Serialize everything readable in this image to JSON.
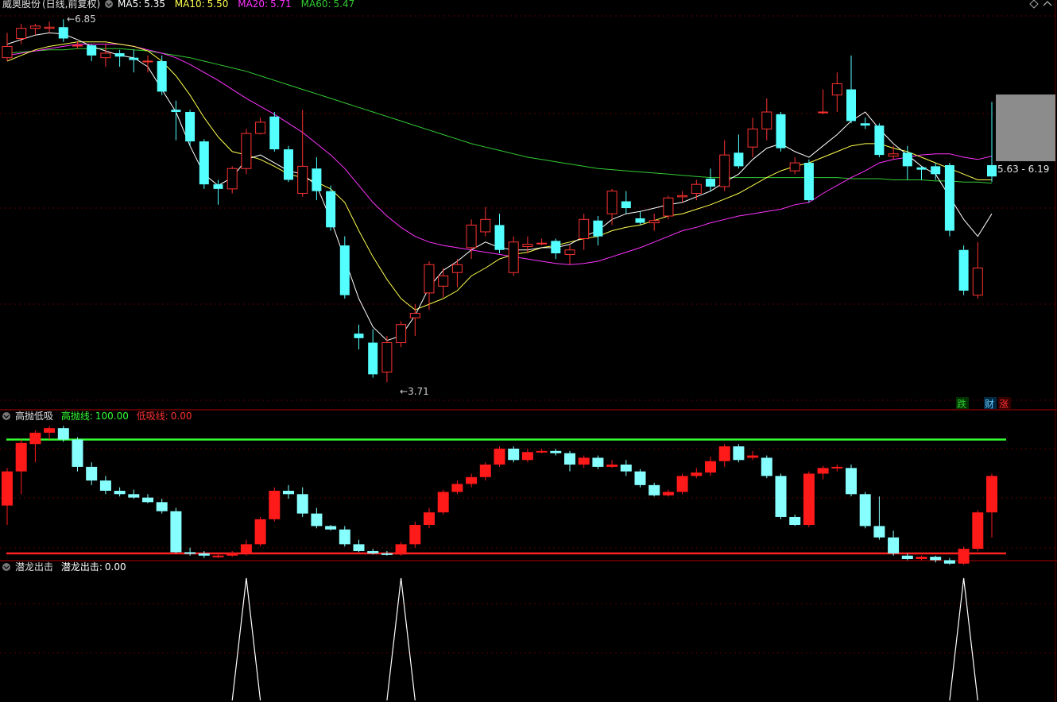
{
  "header": {
    "stock_name": "威奥股份",
    "mode": "(日线,前复权)",
    "ma": [
      {
        "label": "MA5:",
        "value": "5.35",
        "color": "#ffffff"
      },
      {
        "label": "MA10:",
        "value": "5.50",
        "color": "#ffff4d"
      },
      {
        "label": "MA20:",
        "value": "5.71",
        "color": "#ff33ff"
      },
      {
        "label": "MA60:",
        "value": "5.47",
        "color": "#33cc33"
      }
    ]
  },
  "annotations": {
    "high_label": "6.85",
    "low_label": "3.71",
    "range_label": "5.63 - 6.19",
    "badges": [
      {
        "text": "跌",
        "color": "#33cc33"
      },
      {
        "text": "财",
        "color": "#66ccff"
      },
      {
        "text": "涨",
        "color": "#ff3333"
      }
    ]
  },
  "panel2": {
    "title": "高抛低吸",
    "items": [
      {
        "label": "高抛线:",
        "value": "100.00",
        "color": "#33ff33"
      },
      {
        "label": "低吸线:",
        "value": "0.00",
        "color": "#ff3333"
      }
    ]
  },
  "panel3": {
    "title": "潜龙出击",
    "items": [
      {
        "label": "潜龙出击:",
        "value": "0.00",
        "color": "#ffffff"
      }
    ]
  },
  "colors": {
    "up": "#ff3333",
    "down": "#54ffff",
    "ma5": "#ffffff",
    "ma10": "#ffff4d",
    "ma20": "#ff33ff",
    "ma60": "#33cc33",
    "grid": "#5a0000",
    "border": "#b00000"
  },
  "chart_data": [
    {
      "type": "candlestick",
      "title": "威奥股份 (日线,前复权)",
      "price_range": [
        3.6,
        6.95
      ],
      "high": 6.85,
      "low": 3.71,
      "candles": [
        [
          6.58,
          6.68,
          6.8,
          6.55
        ],
        [
          6.75,
          6.84,
          6.88,
          6.7
        ],
        [
          6.84,
          6.86,
          6.88,
          6.78
        ],
        [
          6.84,
          6.85,
          6.9,
          6.8
        ],
        [
          6.85,
          6.75,
          6.92,
          6.72
        ],
        [
          6.69,
          6.69,
          6.72,
          6.66
        ],
        [
          6.69,
          6.6,
          6.7,
          6.55
        ],
        [
          6.58,
          6.62,
          6.7,
          6.5
        ],
        [
          6.62,
          6.59,
          6.65,
          6.5
        ],
        [
          6.58,
          6.56,
          6.65,
          6.45
        ],
        [
          6.55,
          6.55,
          6.6,
          6.45
        ],
        [
          6.55,
          6.28,
          6.6,
          6.25
        ],
        [
          6.12,
          6.1,
          6.2,
          5.85
        ],
        [
          6.1,
          5.84,
          6.12,
          5.8
        ],
        [
          5.84,
          5.46,
          5.86,
          5.42
        ],
        [
          5.46,
          5.42,
          5.5,
          5.28
        ],
        [
          5.42,
          5.6,
          5.62,
          5.38
        ],
        [
          5.6,
          5.91,
          5.95,
          5.55
        ],
        [
          5.91,
          6.01,
          6.05,
          5.9
        ],
        [
          6.06,
          5.77,
          6.1,
          5.75
        ],
        [
          5.77,
          5.5,
          5.8,
          5.48
        ],
        [
          5.38,
          5.62,
          6.12,
          5.35
        ],
        [
          5.6,
          5.4,
          5.7,
          5.32
        ],
        [
          5.4,
          5.08,
          5.45,
          5.05
        ],
        [
          4.92,
          4.48,
          5.0,
          4.45
        ],
        [
          4.14,
          4.1,
          4.22,
          4.0
        ],
        [
          4.06,
          3.78,
          4.18,
          3.75
        ],
        [
          3.8,
          4.06,
          4.12,
          3.71
        ],
        [
          4.06,
          4.22,
          4.25,
          4.02
        ],
        [
          4.28,
          4.32,
          4.4,
          4.12
        ],
        [
          4.5,
          4.75,
          4.78,
          4.35
        ],
        [
          4.56,
          4.65,
          4.72,
          4.46
        ],
        [
          4.68,
          4.75,
          4.8,
          4.55
        ],
        [
          4.9,
          5.1,
          5.15,
          4.8
        ],
        [
          5.04,
          5.15,
          5.26,
          5.0
        ],
        [
          5.1,
          4.88,
          5.2,
          4.85
        ],
        [
          4.68,
          4.95,
          5.0,
          4.65
        ],
        [
          4.91,
          4.93,
          5.0,
          4.85
        ],
        [
          4.94,
          4.94,
          4.98,
          4.92
        ],
        [
          4.96,
          4.85,
          4.98,
          4.8
        ],
        [
          4.84,
          4.88,
          4.92,
          4.75
        ],
        [
          4.98,
          5.15,
          5.2,
          4.88
        ],
        [
          5.14,
          5.0,
          5.18,
          4.92
        ],
        [
          5.2,
          5.4,
          5.42,
          5.1
        ],
        [
          5.31,
          5.25,
          5.4,
          5.2
        ],
        [
          5.16,
          5.12,
          5.22,
          5.1
        ],
        [
          5.12,
          5.14,
          5.2,
          5.05
        ],
        [
          5.18,
          5.34,
          5.36,
          5.15
        ],
        [
          5.35,
          5.36,
          5.4,
          5.3
        ],
        [
          5.38,
          5.46,
          5.5,
          5.32
        ],
        [
          5.51,
          5.44,
          5.6,
          5.4
        ],
        [
          5.44,
          5.72,
          5.85,
          5.4
        ],
        [
          5.74,
          5.62,
          5.9,
          5.6
        ],
        [
          5.79,
          5.95,
          6.05,
          5.7
        ],
        [
          5.95,
          6.1,
          6.22,
          5.85
        ],
        [
          6.08,
          5.78,
          6.1,
          5.75
        ],
        [
          5.58,
          5.65,
          5.7,
          5.55
        ],
        [
          5.65,
          5.32,
          5.68,
          5.3
        ],
        [
          6.1,
          6.1,
          6.3,
          6.08
        ],
        [
          6.25,
          6.35,
          6.45,
          6.1
        ],
        [
          6.3,
          6.02,
          6.6,
          6.0
        ],
        [
          6.0,
          5.98,
          6.05,
          5.95
        ],
        [
          5.98,
          5.72,
          6.0,
          5.7
        ],
        [
          5.71,
          5.73,
          5.8,
          5.68
        ],
        [
          5.74,
          5.62,
          5.8,
          5.5
        ],
        [
          5.61,
          5.59,
          5.62,
          5.5
        ],
        [
          5.62,
          5.55,
          5.65,
          5.5
        ],
        [
          5.63,
          5.05,
          5.65,
          5.0
        ],
        [
          4.88,
          4.52,
          4.92,
          4.48
        ],
        [
          4.48,
          4.72,
          4.95,
          4.45
        ],
        [
          5.63,
          5.53,
          6.19,
          5.48
        ]
      ],
      "ma5": [
        6.7,
        6.74,
        6.78,
        6.8,
        6.79,
        6.74,
        6.68,
        6.64,
        6.6,
        6.58,
        6.5,
        6.3,
        6.1,
        5.8,
        5.55,
        5.45,
        5.52,
        5.68,
        5.72,
        5.65,
        5.58,
        5.55,
        5.45,
        5.15,
        4.8,
        4.45,
        4.2,
        4.08,
        4.12,
        4.3,
        4.55,
        4.7,
        4.78,
        4.88,
        4.95,
        4.9,
        4.88,
        4.88,
        4.9,
        4.9,
        4.93,
        5.0,
        5.05,
        5.15,
        5.2,
        5.22,
        5.25,
        5.28,
        5.3,
        5.35,
        5.4,
        5.48,
        5.55,
        5.68,
        5.78,
        5.82,
        5.75,
        5.7,
        5.8,
        5.9,
        6.02,
        6.1,
        5.95,
        5.82,
        5.72,
        5.62,
        5.55,
        5.35,
        5.15,
        5.0,
        5.2
      ],
      "ma10": [
        6.55,
        6.6,
        6.65,
        6.68,
        6.7,
        6.72,
        6.72,
        6.72,
        6.7,
        6.68,
        6.64,
        6.55,
        6.42,
        6.25,
        6.05,
        5.88,
        5.75,
        5.72,
        5.68,
        5.62,
        5.55,
        5.52,
        5.48,
        5.42,
        5.3,
        5.05,
        4.82,
        4.62,
        4.45,
        4.35,
        4.4,
        4.45,
        4.52,
        4.65,
        4.72,
        4.8,
        4.84,
        4.86,
        4.9,
        4.92,
        4.95,
        4.98,
        5.0,
        5.05,
        5.08,
        5.1,
        5.14,
        5.18,
        5.2,
        5.24,
        5.28,
        5.33,
        5.38,
        5.45,
        5.52,
        5.58,
        5.62,
        5.65,
        5.7,
        5.75,
        5.8,
        5.82,
        5.82,
        5.78,
        5.75,
        5.7,
        5.65,
        5.6,
        5.55,
        5.5,
        5.5
      ],
      "ma20": [
        6.6,
        6.62,
        6.64,
        6.66,
        6.68,
        6.7,
        6.7,
        6.7,
        6.7,
        6.68,
        6.65,
        6.62,
        6.58,
        6.52,
        6.45,
        6.38,
        6.3,
        6.22,
        6.15,
        6.08,
        6.0,
        5.92,
        5.82,
        5.72,
        5.6,
        5.45,
        5.3,
        5.18,
        5.08,
        5.0,
        4.95,
        4.92,
        4.9,
        4.88,
        4.86,
        4.84,
        4.82,
        4.8,
        4.78,
        4.76,
        4.75,
        4.76,
        4.78,
        4.82,
        4.86,
        4.9,
        4.95,
        5.0,
        5.05,
        5.08,
        5.12,
        5.15,
        5.18,
        5.2,
        5.22,
        5.24,
        5.28,
        5.3,
        5.38,
        5.45,
        5.52,
        5.58,
        5.65,
        5.68,
        5.7,
        5.72,
        5.73,
        5.73,
        5.7,
        5.68,
        5.71
      ],
      "ma60": [
        6.62,
        6.63,
        6.64,
        6.65,
        6.65,
        6.66,
        6.66,
        6.66,
        6.66,
        6.65,
        6.64,
        6.62,
        6.6,
        6.58,
        6.55,
        6.52,
        6.49,
        6.46,
        6.42,
        6.38,
        6.34,
        6.3,
        6.26,
        6.22,
        6.18,
        6.14,
        6.1,
        6.06,
        6.02,
        5.98,
        5.94,
        5.9,
        5.86,
        5.82,
        5.79,
        5.76,
        5.73,
        5.7,
        5.68,
        5.66,
        5.64,
        5.62,
        5.6,
        5.59,
        5.58,
        5.57,
        5.56,
        5.55,
        5.54,
        5.53,
        5.52,
        5.52,
        5.52,
        5.52,
        5.52,
        5.52,
        5.52,
        5.52,
        5.52,
        5.52,
        5.51,
        5.51,
        5.51,
        5.5,
        5.5,
        5.5,
        5.49,
        5.49,
        5.48,
        5.48,
        5.47
      ]
    },
    {
      "type": "candlestick",
      "title": "高抛低吸",
      "y_range": [
        -5,
        115
      ],
      "lines": {
        "high_sell": 100,
        "low_buy": 0
      },
      "candles": [
        [
          42,
          72,
          75,
          25
        ],
        [
          72,
          97,
          100,
          52
        ],
        [
          96,
          106,
          108,
          80
        ],
        [
          106,
          110,
          112,
          100
        ],
        [
          110,
          100,
          112,
          98
        ],
        [
          100,
          76,
          102,
          72
        ],
        [
          76,
          64,
          80,
          60
        ],
        [
          64,
          55,
          68,
          52
        ],
        [
          55,
          52,
          58,
          50
        ],
        [
          52,
          49,
          56,
          48
        ],
        [
          49,
          45,
          52,
          44
        ],
        [
          45,
          37,
          48,
          35
        ],
        [
          37,
          1,
          40,
          0
        ],
        [
          1,
          0,
          5,
          -2
        ],
        [
          0,
          -2,
          2,
          -4
        ],
        [
          -2,
          -2,
          0,
          -4
        ],
        [
          -2,
          0,
          2,
          -3
        ],
        [
          0,
          8,
          12,
          -2
        ],
        [
          8,
          30,
          32,
          6
        ],
        [
          30,
          55,
          58,
          28
        ],
        [
          55,
          52,
          60,
          48
        ],
        [
          52,
          35,
          58,
          32
        ],
        [
          35,
          24,
          40,
          22
        ],
        [
          24,
          21,
          25,
          20
        ],
        [
          21,
          8,
          24,
          6
        ],
        [
          8,
          2,
          12,
          1
        ],
        [
          2,
          0,
          4,
          -1
        ],
        [
          0,
          -1,
          2,
          -2
        ],
        [
          -1,
          8,
          10,
          -2
        ],
        [
          8,
          25,
          28,
          5
        ],
        [
          25,
          36,
          40,
          22
        ],
        [
          36,
          54,
          56,
          34
        ],
        [
          54,
          61,
          64,
          52
        ],
        [
          61,
          67,
          70,
          58
        ],
        [
          67,
          78,
          80,
          64
        ],
        [
          78,
          92,
          94,
          76
        ],
        [
          92,
          82,
          94,
          80
        ],
        [
          82,
          89,
          92,
          80
        ],
        [
          89,
          90,
          92,
          88
        ],
        [
          90,
          88,
          92,
          86
        ],
        [
          88,
          78,
          90,
          72
        ],
        [
          78,
          84,
          86,
          75
        ],
        [
          84,
          76,
          86,
          74
        ],
        [
          76,
          78,
          82,
          75
        ],
        [
          78,
          72,
          82,
          68
        ],
        [
          72,
          60,
          74,
          58
        ],
        [
          60,
          51,
          62,
          50
        ],
        [
          51,
          54,
          56,
          50
        ],
        [
          54,
          68,
          70,
          52
        ],
        [
          68,
          71,
          75,
          66
        ],
        [
          71,
          81,
          85,
          68
        ],
        [
          81,
          94,
          96,
          76
        ],
        [
          94,
          82,
          96,
          80
        ],
        [
          84,
          86,
          90,
          82
        ],
        [
          84,
          68,
          86,
          66
        ],
        [
          68,
          32,
          70,
          30
        ],
        [
          32,
          25,
          34,
          24
        ],
        [
          25,
          70,
          72,
          23
        ],
        [
          70,
          75,
          77,
          65
        ],
        [
          75,
          76,
          78,
          72
        ],
        [
          75,
          52,
          78,
          50
        ],
        [
          52,
          24,
          54,
          22
        ],
        [
          24,
          14,
          50,
          12
        ],
        [
          14,
          0,
          20,
          -2
        ],
        [
          -2,
          -5,
          0,
          -6
        ],
        [
          -5,
          -3,
          -2,
          -6
        ],
        [
          -3,
          -6,
          -2,
          -8
        ],
        [
          -6,
          -9,
          -4,
          -10
        ],
        [
          -9,
          4,
          6,
          -10
        ],
        [
          4,
          36,
          38,
          2
        ],
        [
          36,
          68,
          70,
          14
        ]
      ]
    },
    {
      "type": "line",
      "title": "潜龙出击",
      "y_range": [
        0,
        100
      ],
      "values": [
        0,
        0,
        0,
        0,
        0,
        0,
        0,
        0,
        0,
        0,
        0,
        0,
        0,
        0,
        0,
        0,
        0,
        0,
        0,
        0,
        0,
        0,
        0,
        0,
        0,
        0,
        0,
        0,
        0,
        0,
        0,
        0,
        0,
        0,
        0,
        0,
        0,
        0,
        0,
        0,
        0,
        0,
        0,
        0,
        0,
        0,
        0,
        0,
        0,
        0,
        0,
        0,
        0,
        0,
        0,
        0,
        0,
        0,
        0,
        0,
        0,
        0,
        0,
        0,
        0,
        0,
        0,
        0,
        0,
        0,
        0
      ],
      "spikes": [
        {
          "index": 17,
          "value": 100
        },
        {
          "index": 28,
          "value": 100
        },
        {
          "index": 68,
          "value": 100
        }
      ]
    }
  ]
}
